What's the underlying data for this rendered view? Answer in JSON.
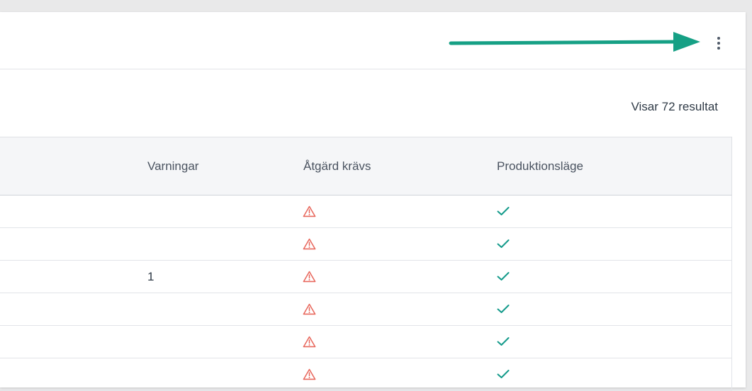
{
  "toolbar": {
    "more_icon": "more-vertical-icon",
    "annotation_arrow_color": "#16a085"
  },
  "results": {
    "label": "Visar 72 resultat"
  },
  "table": {
    "columns": [
      "Varningar",
      "Åtgärd krävs",
      "Produktionsläge"
    ],
    "rows": [
      {
        "warnings": "",
        "action_required": "alert-triangle-icon",
        "production_mode": "check-icon"
      },
      {
        "warnings": "",
        "action_required": "alert-triangle-icon",
        "production_mode": "check-icon"
      },
      {
        "warnings": "1",
        "action_required": "alert-triangle-icon",
        "production_mode": "check-icon"
      },
      {
        "warnings": "",
        "action_required": "alert-triangle-icon",
        "production_mode": "check-icon"
      },
      {
        "warnings": "",
        "action_required": "alert-triangle-icon",
        "production_mode": "check-icon"
      },
      {
        "warnings": "",
        "action_required": "alert-triangle-icon",
        "production_mode": "check-icon"
      }
    ]
  },
  "colors": {
    "alert": "#e8685d",
    "check": "#139a8a",
    "header_bg": "#f5f6f8"
  }
}
